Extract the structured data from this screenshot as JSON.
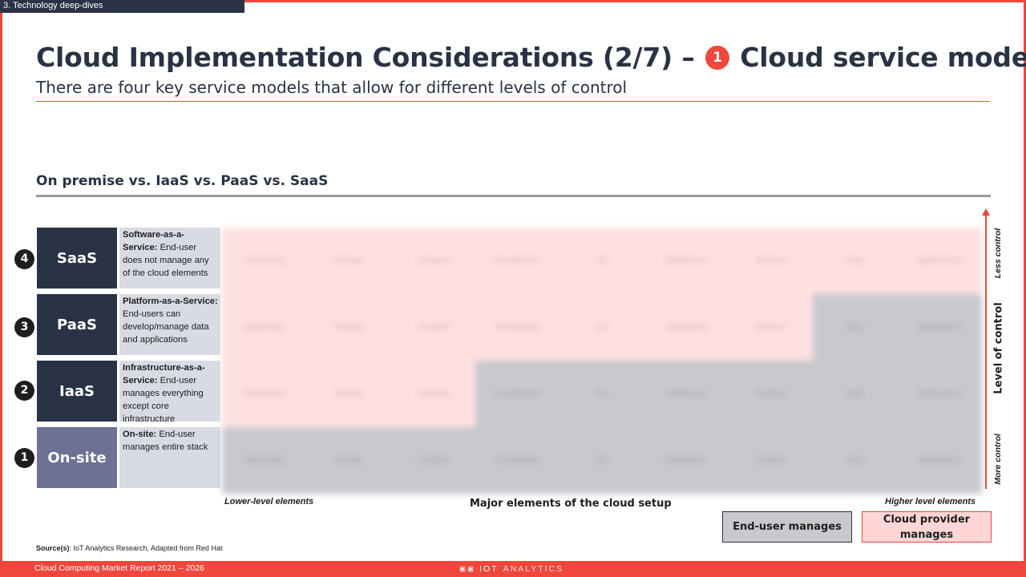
{
  "section_tag": "3. Technology deep-dives",
  "title": {
    "before": "Cloud Implementation Considerations (2/7) –",
    "badge": "1",
    "after": "Cloud service model"
  },
  "subtitle": "There are four key service models that allow for different levels of control",
  "chart_heading": "On premise vs. IaaS vs. PaaS vs. SaaS",
  "rows": [
    {
      "num": "4",
      "label": "SaaS",
      "desc_bold": "Software-as-a-Service:",
      "desc": " End-user does not manage any of the cloud elements"
    },
    {
      "num": "3",
      "label": "PaaS",
      "desc_bold": "Platform-as-a-Service:",
      "desc": " End-users can develop/manage data and applications"
    },
    {
      "num": "2",
      "label": "IaaS",
      "desc_bold": "Infrastructure-as-a-Service:",
      "desc": " End-user manages everything except core infrastructure"
    },
    {
      "num": "1",
      "label": "On-site",
      "desc_bold": "On-site:",
      "desc": " End-user manages entire stack"
    }
  ],
  "columns": [
    "Networking",
    "Storage",
    "Compute",
    "Virtualization",
    "OS",
    "Middleware",
    "Runtime",
    "Data",
    "Applications"
  ],
  "provider_managed_columns": {
    "SaaS": 9,
    "PaaS": 7,
    "IaaS": 3,
    "On-site": 0
  },
  "axis": {
    "top": "Less control",
    "middle": "Level of control",
    "bottom": "More control",
    "x_left": "Lower-level elements",
    "x_center": "Major elements of the cloud setup",
    "x_right": "Higher level elements"
  },
  "legend": {
    "user": "End-user manages",
    "provider": "Cloud provider manages"
  },
  "colors": {
    "accent": "#f0473c",
    "navy": "#2a3245",
    "onsite": "#6d7193",
    "provider_fill": "#ffe0e0",
    "user_fill": "#c7c9cd"
  },
  "source": {
    "label": "Source(s)",
    "text": ": IoT Analytics Research, Adapted from Red Hat"
  },
  "footer": {
    "report": "Cloud Computing Market Report 2021 – 2026",
    "logo_bold": "IOT",
    "logo_light": "ANALYTICS"
  }
}
